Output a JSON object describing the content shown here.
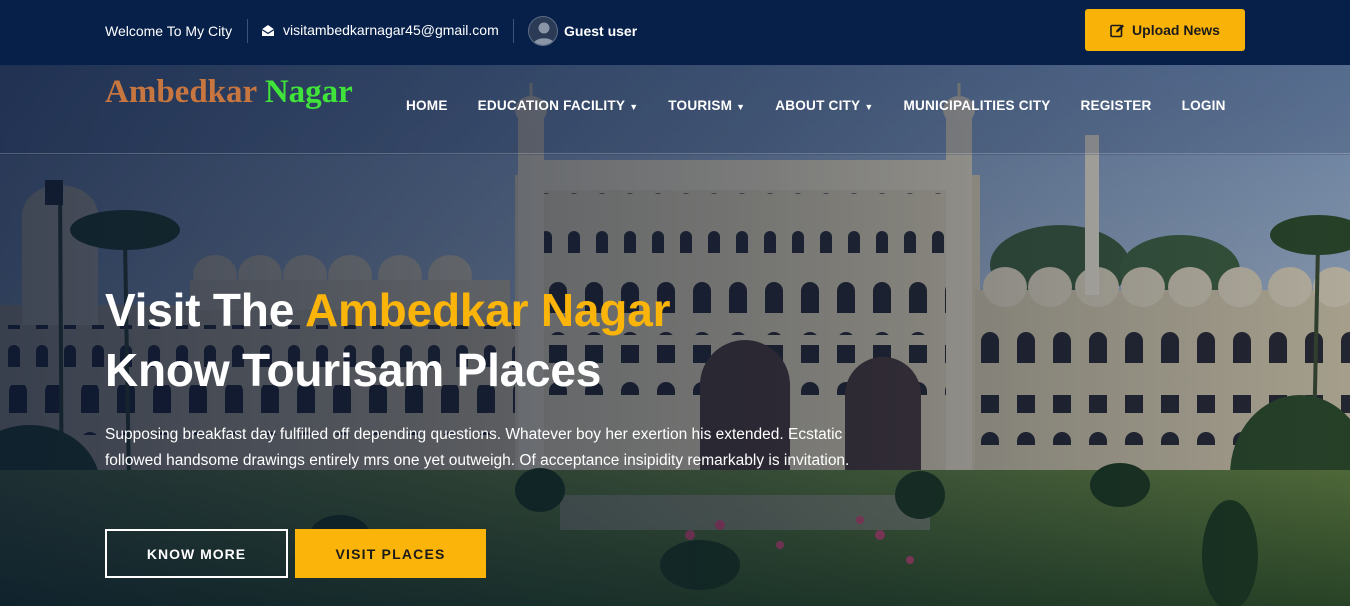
{
  "topbar": {
    "welcome": "Welcome To My City",
    "email": "visitambedkarnagar45@gmail.com",
    "user_name": "Guest user",
    "upload_label": "Upload News"
  },
  "logo": {
    "part1": "Ambedkar",
    "part2": "Nagar"
  },
  "nav": {
    "items": [
      {
        "label": "HOME",
        "dropdown": false
      },
      {
        "label": "EDUCATION FACILITY",
        "dropdown": true
      },
      {
        "label": "TOURISM",
        "dropdown": true
      },
      {
        "label": "ABOUT CITY",
        "dropdown": true
      },
      {
        "label": "MUNICIPALITIES CITY",
        "dropdown": false
      },
      {
        "label": "REGISTER",
        "dropdown": false
      },
      {
        "label": "LOGIN",
        "dropdown": false
      }
    ]
  },
  "hero": {
    "title_prefix": "Visit The",
    "title_highlight": "Ambedkar Nagar",
    "title_line2": "Know Tourisam Places",
    "description": "Supposing breakfast day fulfilled off depending questions. Whatever boy her exertion his extended. Ecstatic followed handsome drawings entirely mrs one yet outweigh. Of acceptance insipidity remarkably is invitation.",
    "button_primary": "KNOW MORE",
    "button_secondary": "VISIT PLACES"
  },
  "colors": {
    "topbar_bg": "#06204a",
    "accent": "#fbb40a",
    "logo_part1": "#c8763f",
    "logo_part2": "#3fe33a"
  },
  "icons": [
    "envelope-open-icon",
    "user-avatar-icon",
    "edit-icon",
    "chevron-down-icon"
  ]
}
